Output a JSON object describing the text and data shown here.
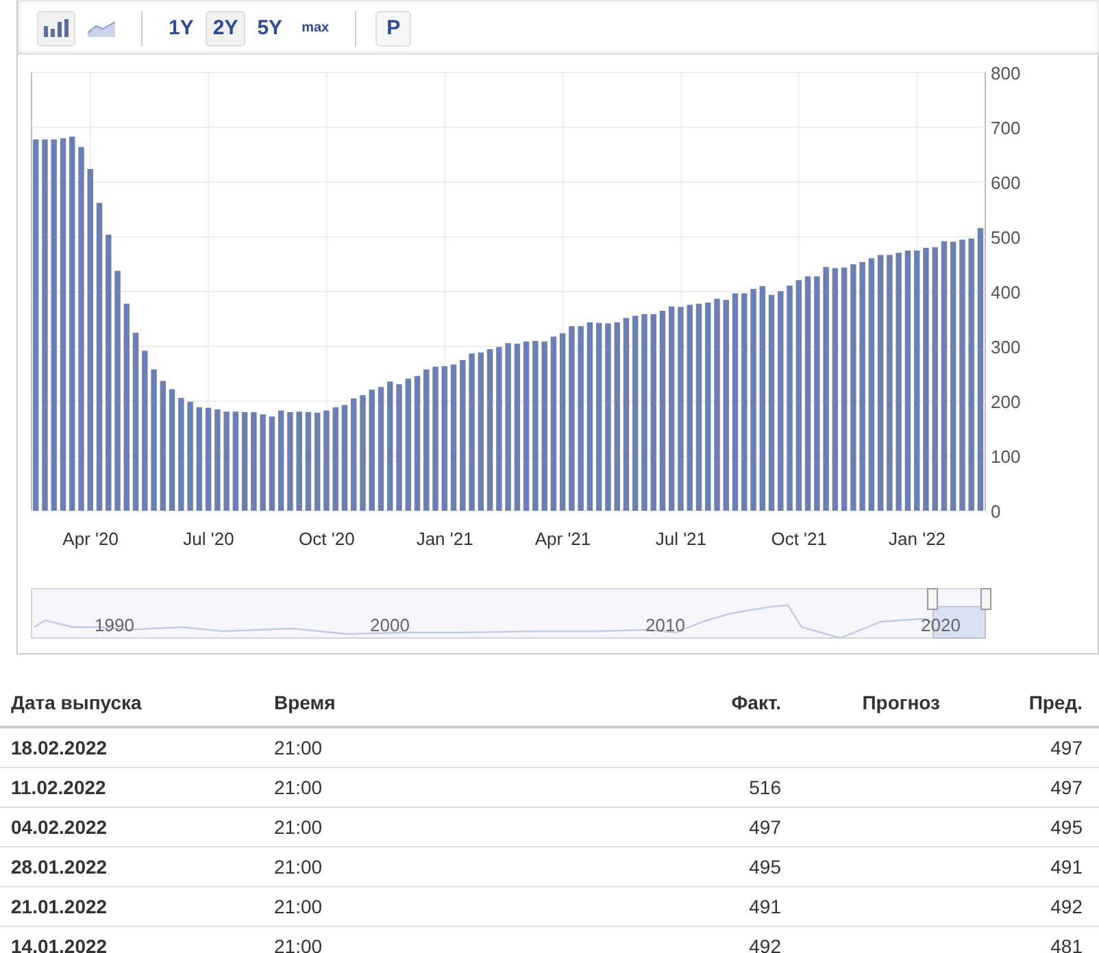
{
  "toolbar": {
    "chart_types": [
      {
        "kind": "bar",
        "selected": true
      },
      {
        "kind": "area",
        "selected": false
      }
    ],
    "ranges": [
      {
        "label": "1Y",
        "selected": false
      },
      {
        "label": "2Y",
        "selected": true
      },
      {
        "label": "5Y",
        "selected": false
      },
      {
        "label": "max",
        "selected": false
      }
    ],
    "extra_button": "P"
  },
  "chart": {
    "x_axis_labels": [
      "Apr '20",
      "Jul '20",
      "Oct '20",
      "Jan '21",
      "Apr '21",
      "Jul '21",
      "Oct '21",
      "Jan '22"
    ],
    "chart_data": {
      "type": "bar",
      "grid": true,
      "ylim": [
        0,
        800
      ],
      "yticks": [
        0,
        100,
        200,
        300,
        400,
        500,
        600,
        700,
        800
      ],
      "series": [
        {
          "color": "#6a7fb3",
          "values": [
            678,
            678,
            678,
            680,
            683,
            664,
            624,
            562,
            504,
            438,
            378,
            325,
            292,
            258,
            237,
            222,
            206,
            199,
            189,
            188,
            185,
            181,
            181,
            180,
            180,
            176,
            172,
            183,
            180,
            181,
            180,
            179,
            183,
            189,
            193,
            205,
            211,
            221,
            226,
            236,
            231,
            241,
            246,
            258,
            263,
            264,
            267,
            275,
            287,
            289,
            295,
            299,
            306,
            305,
            309,
            310,
            309,
            318,
            324,
            337,
            337,
            344,
            343,
            342,
            344,
            352,
            356,
            359,
            359,
            365,
            373,
            372,
            376,
            378,
            380,
            387,
            385,
            397,
            397,
            405,
            410,
            394,
            401,
            411,
            421,
            428,
            428,
            445,
            443,
            444,
            450,
            454,
            461,
            467,
            467,
            471,
            475,
            475,
            480,
            481,
            492,
            491,
            495,
            497,
            516
          ]
        }
      ]
    }
  },
  "navigator": {
    "labels": [
      "1990",
      "2000",
      "2010",
      "2020"
    ]
  },
  "table": {
    "columns": [
      "Дата выпуска",
      "Время",
      "Факт.",
      "Прогноз",
      "Пред."
    ],
    "rows": [
      {
        "date": "18.02.2022",
        "time": "21:00",
        "actual": "",
        "forecast": "",
        "previous": "497"
      },
      {
        "date": "11.02.2022",
        "time": "21:00",
        "actual": "516",
        "forecast": "",
        "previous": "497"
      },
      {
        "date": "04.02.2022",
        "time": "21:00",
        "actual": "497",
        "forecast": "",
        "previous": "495"
      },
      {
        "date": "28.01.2022",
        "time": "21:00",
        "actual": "495",
        "forecast": "",
        "previous": "491"
      },
      {
        "date": "21.01.2022",
        "time": "21:00",
        "actual": "491",
        "forecast": "",
        "previous": "492"
      },
      {
        "date": "14.01.2022",
        "time": "21:00",
        "actual": "492",
        "forecast": "",
        "previous": "481"
      }
    ]
  }
}
